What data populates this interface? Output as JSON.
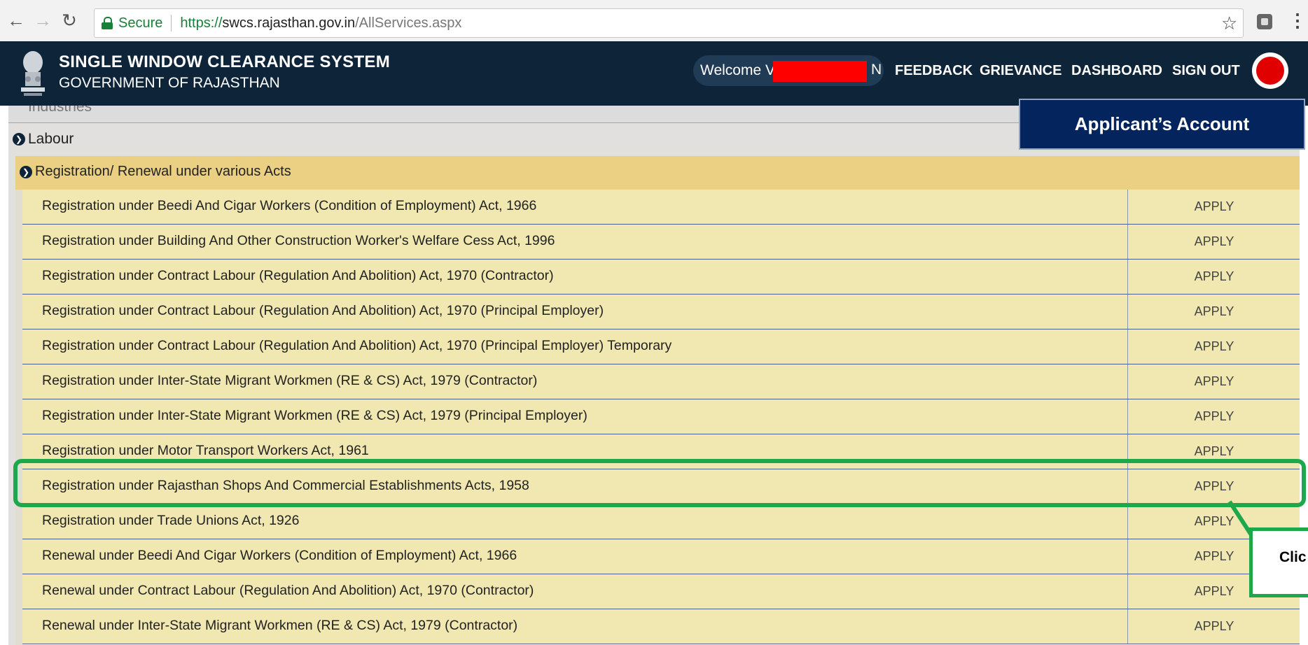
{
  "browser": {
    "secure_label": "Secure",
    "url_scheme": "https://",
    "url_host": "swcs.rajasthan.gov.in",
    "url_path": "/AllServices.aspx"
  },
  "header": {
    "title": "SINGLE WINDOW CLEARANCE SYSTEM",
    "subtitle": "GOVERNMENT OF RAJASTHAN",
    "welcome_prefix": "Welcome V",
    "welcome_suffix": "N",
    "nav": [
      "FEEDBACK",
      "GRIEVANCE",
      "DASHBOARD",
      "SIGN OUT"
    ]
  },
  "tree": {
    "cut_off_item": "Industries",
    "labour_label": "Labour",
    "section_label": "Registration/ Renewal under various Acts"
  },
  "apply_label": "APPLY",
  "services": [
    "Registration under Beedi And Cigar Workers (Condition of Employment) Act, 1966",
    "Registration under Building And Other Construction Worker's Welfare Cess Act, 1996",
    "Registration under Contract Labour (Regulation And Abolition) Act, 1970 (Contractor)",
    "Registration under Contract Labour (Regulation And Abolition) Act, 1970 (Principal Employer)",
    "Registration under Contract Labour (Regulation And Abolition) Act, 1970 (Principal Employer) Temporary",
    "Registration under Inter-State Migrant Workmen (RE & CS) Act, 1979 (Contractor)",
    "Registration under Inter-State Migrant Workmen (RE & CS) Act, 1979 (Principal Employer)",
    "Registration under Motor Transport Workers Act, 1961",
    "Registration under Rajasthan Shops And Commercial Establishments Acts, 1958",
    "Registration under Trade Unions Act, 1926",
    "Renewal under Beedi And Cigar Workers (Condition of Employment) Act, 1966",
    "Renewal under Contract Labour (Regulation And Abolition) Act, 1970 (Contractor)",
    "Renewal under Inter-State Migrant Workmen (RE & CS) Act, 1979 (Contractor)"
  ],
  "annotations": {
    "account_label": "Applicant’s Account",
    "callout_text": "Clic",
    "highlight_color": "#1fa84b",
    "account_bg": "#04245e"
  },
  "colors": {
    "header_bg": "#0e2438",
    "row_bg": "#f0e8b0",
    "section_bg": "#ebd083"
  }
}
